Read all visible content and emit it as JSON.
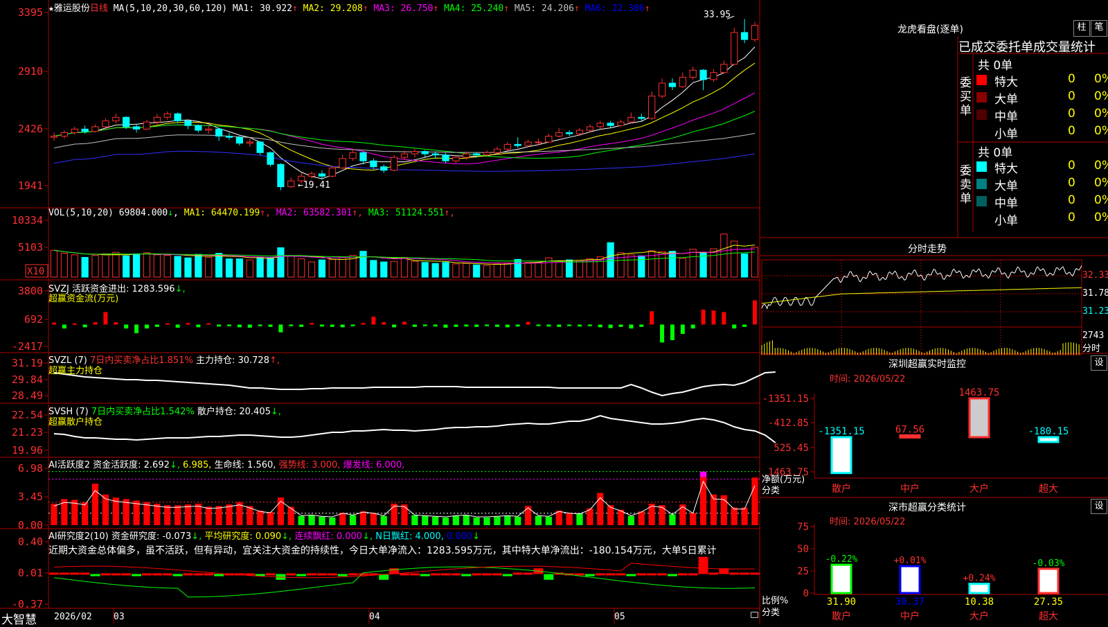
{
  "app": {
    "logo": "大智慧",
    "lock_icon": "lock-icon"
  },
  "stock": {
    "star": "★",
    "name": "雅运股份",
    "period": "日线"
  },
  "main": {
    "ma_label": "MA(5,10,20,30,60,120)",
    "ma": [
      {
        "label": "MA1: 30.922",
        "arrow": "↑",
        "color": "#ffffff"
      },
      {
        "label": "MA2: 29.208",
        "arrow": "↑",
        "color": "#ffff00"
      },
      {
        "label": "MA3: 26.750",
        "arrow": "↑",
        "color": "#ff00ff"
      },
      {
        "label": "MA4: 25.240",
        "arrow": "↑",
        "color": "#00ff00"
      },
      {
        "label": "MA5: 24.206",
        "arrow": "↑",
        "color": "#c0c0c0"
      },
      {
        "label": "MA6: 22.306",
        "arrow": "↑",
        "color": "#0000ff"
      }
    ],
    "y_ticks": [
      "3395",
      "2910",
      "2426",
      "1941"
    ],
    "high_label": "33.95",
    "low_label": "←19.41"
  },
  "vol": {
    "header": "VOL(5,10,20)",
    "value": "69804.000",
    "value_arrow": "↓",
    "ma": [
      {
        "label": "MA1: 64470.199",
        "arrow": "↑",
        "color": "#ffff00"
      },
      {
        "label": "MA2: 63582.301",
        "arrow": "↑",
        "color": "#ff00ff"
      },
      {
        "label": "MA3: 51124.551",
        "arrow": "↑",
        "color": "#00ff00"
      }
    ],
    "y_ticks": [
      "10334",
      "5103"
    ],
    "unit": "X10"
  },
  "svzj": {
    "line1": "SVZJ  活跃资金进出: 1283.596",
    "line1_arrow": "↓,",
    "line2": "超赢资金流(万元)",
    "y_ticks": [
      "3800",
      "692",
      "-2417"
    ]
  },
  "svzl": {
    "prefix": "SVZL (7)",
    "green": "7日内买卖净占比1.851%",
    "white": "主力持仓: 30.728",
    "arrow": "↑,",
    "line2": "超赢主力持仓",
    "y_ticks": [
      "31.19",
      "29.84",
      "28.49"
    ]
  },
  "svsh": {
    "prefix": "SVSH (7)",
    "green": "7日内买卖净占比1.542%",
    "white": "散户持仓: 20.405",
    "arrow": "↓,",
    "line2": "超赢散户持仓",
    "y_ticks": [
      "22.54",
      "21.23",
      "19.96"
    ]
  },
  "ai_active": {
    "title": "AI活跃度2",
    "item1": "资金活跃度: 2.692",
    "item1b": "6.985,",
    "item2": "生命线: 1.560,",
    "item3": "强势线: 3.000,",
    "item4": "爆发线: 6.000,",
    "y_ticks": [
      "6.98",
      "3.45",
      "0.00"
    ]
  },
  "ai_research": {
    "title": "AI研究度2(10)",
    "item1": "资金研究度: -0.073",
    "item2": "平均研究度: 0.090",
    "item3": "连续飘红: 0.000",
    "item4": "N日飘红: 4.000,",
    "item5": "0.000",
    "comment": "近期大资金总体偏多，虽不活跃，但有异动，宜关注大资金的持续性，今日大单净流入：1283.595万元，其中特大单净流出：-180.154万元，大单5日累计",
    "y_ticks": [
      "0.40",
      "0.01",
      "-0.37"
    ]
  },
  "x_axis": [
    "2026/02",
    "03",
    "04",
    "05"
  ],
  "dragon_tiger": {
    "title": "龙虎看盘(逐单)",
    "btn_bar": "柱",
    "btn_pen": "笔",
    "header": "已成交委托单成交量统计",
    "buy": {
      "side_label": "委买单",
      "total": "共 0单",
      "rows": [
        {
          "label": "特大",
          "value": "0",
          "pct": "0%",
          "color": "#ff0000"
        },
        {
          "label": "大单",
          "value": "0",
          "pct": "0%",
          "color": "#8b0000"
        },
        {
          "label": "中单",
          "value": "0",
          "pct": "0%",
          "color": "#500000"
        },
        {
          "label": "小单",
          "value": "0",
          "pct": "0%",
          "color": ""
        }
      ]
    },
    "sell": {
      "side_label": "委卖单",
      "total": "共 0单",
      "rows": [
        {
          "label": "特大",
          "value": "0",
          "pct": "0%",
          "color": "#00ffff"
        },
        {
          "label": "大单",
          "value": "0",
          "pct": "0%",
          "color": "#008080"
        },
        {
          "label": "中单",
          "value": "0",
          "pct": "0%",
          "color": "#006060"
        },
        {
          "label": "小单",
          "value": "0",
          "pct": "0%",
          "color": ""
        }
      ]
    }
  },
  "intraday": {
    "title": "分时走势",
    "price_ticks": [
      "32.33",
      "31.78",
      "31.23"
    ],
    "vol_tick": "2743",
    "vol_unit": "分时"
  },
  "sz_monitor": {
    "title": "深圳超赢实时监控",
    "btn": "设",
    "time": "时间: 2026/05/22",
    "y_ticks": [
      "1463.75",
      "525.45",
      "-412.85",
      "-1351.15"
    ],
    "ylabel1": "净额(万元)",
    "ylabel2": "分类"
  },
  "sz_stats": {
    "title": "深市超赢分类统计",
    "btn": "设",
    "time": "时间: 2026/05/22",
    "y_ticks": [
      "75",
      "50",
      "25",
      "0"
    ],
    "ylabel1": "比例%",
    "ylabel2": "分类"
  },
  "chart_data": [
    {
      "type": "candlestick",
      "title": "雅运股份 日线",
      "y_ticks": [
        19.41,
        24.26,
        29.1,
        33.95
      ],
      "ylim": [
        18.5,
        34.5
      ],
      "annotations": {
        "high": 33.95,
        "low": 19.41
      },
      "candles": [
        [
          23.9,
          24.0,
          24.3,
          23.6
        ],
        [
          24.0,
          24.3,
          24.5,
          23.8
        ],
        [
          24.3,
          24.6,
          24.8,
          24.1
        ],
        [
          24.6,
          24.4,
          24.9,
          24.2
        ],
        [
          24.4,
          24.8,
          25.0,
          24.3
        ],
        [
          24.8,
          25.3,
          25.5,
          24.7
        ],
        [
          25.3,
          25.6,
          25.9,
          25.1
        ],
        [
          25.6,
          24.8,
          25.7,
          24.6
        ],
        [
          24.8,
          24.6,
          25.0,
          24.3
        ],
        [
          24.6,
          25.2,
          25.4,
          24.5
        ],
        [
          25.2,
          25.6,
          25.9,
          25.0
        ],
        [
          25.6,
          25.9,
          26.1,
          25.4
        ],
        [
          25.9,
          25.3,
          26.0,
          25.1
        ],
        [
          25.3,
          24.9,
          25.4,
          24.6
        ],
        [
          24.9,
          24.5,
          25.0,
          24.3
        ],
        [
          24.5,
          24.6,
          24.9,
          24.2
        ],
        [
          24.6,
          24.0,
          24.7,
          23.6
        ],
        [
          24.0,
          23.9,
          24.3,
          23.7
        ],
        [
          23.9,
          23.4,
          24.0,
          23.2
        ],
        [
          23.4,
          23.5,
          23.8,
          23.1
        ],
        [
          23.5,
          22.6,
          23.6,
          22.4
        ],
        [
          22.6,
          21.6,
          22.7,
          21.4
        ],
        [
          21.6,
          19.7,
          21.7,
          19.41
        ],
        [
          19.7,
          20.2,
          20.5,
          19.6
        ],
        [
          20.2,
          20.6,
          20.9,
          20.0
        ],
        [
          20.6,
          20.8,
          21.0,
          20.4
        ],
        [
          20.8,
          20.6,
          21.1,
          20.3
        ],
        [
          20.6,
          21.3,
          21.5,
          20.5
        ],
        [
          21.3,
          22.1,
          22.4,
          21.2
        ],
        [
          22.1,
          22.6,
          22.9,
          21.9
        ],
        [
          22.6,
          21.9,
          22.7,
          21.6
        ],
        [
          21.9,
          21.4,
          22.1,
          21.2
        ],
        [
          21.4,
          21.1,
          21.6,
          20.9
        ],
        [
          21.1,
          22.2,
          22.4,
          21.0
        ],
        [
          22.2,
          22.5,
          22.8,
          22.0
        ],
        [
          22.5,
          22.7,
          22.9,
          22.2
        ],
        [
          22.7,
          22.5,
          22.8,
          22.2
        ],
        [
          22.5,
          22.4,
          22.7,
          22.1
        ],
        [
          22.4,
          21.9,
          22.6,
          21.7
        ],
        [
          21.9,
          22.2,
          22.4,
          21.7
        ],
        [
          22.2,
          22.5,
          22.7,
          22.0
        ],
        [
          22.5,
          22.4,
          22.6,
          22.2
        ],
        [
          22.4,
          22.6,
          22.8,
          22.3
        ],
        [
          22.6,
          22.9,
          23.1,
          22.5
        ],
        [
          22.9,
          23.3,
          23.5,
          22.8
        ],
        [
          23.3,
          23.2,
          23.9,
          23.0
        ],
        [
          23.2,
          23.5,
          23.7,
          23.1
        ],
        [
          23.5,
          23.5,
          23.8,
          23.2
        ],
        [
          23.5,
          24.0,
          24.2,
          23.4
        ],
        [
          24.0,
          24.3,
          24.7,
          23.9
        ],
        [
          24.3,
          24.2,
          24.5,
          24.0
        ],
        [
          24.2,
          24.5,
          24.7,
          24.0
        ],
        [
          24.5,
          24.8,
          25.0,
          24.3
        ],
        [
          24.8,
          25.1,
          25.3,
          24.6
        ],
        [
          25.1,
          24.9,
          25.3,
          24.7
        ],
        [
          24.9,
          25.2,
          25.4,
          24.8
        ],
        [
          25.2,
          25.6,
          26.0,
          25.1
        ],
        [
          25.6,
          25.5,
          25.9,
          25.3
        ],
        [
          25.5,
          27.4,
          27.8,
          25.4
        ],
        [
          27.4,
          28.5,
          28.9,
          27.2
        ],
        [
          28.5,
          28.2,
          28.9,
          27.9
        ],
        [
          28.2,
          29.0,
          29.4,
          28.1
        ],
        [
          29.0,
          29.6,
          29.9,
          28.8
        ],
        [
          29.6,
          28.8,
          29.7,
          27.9
        ],
        [
          28.8,
          29.4,
          29.7,
          28.6
        ],
        [
          29.4,
          30.1,
          30.4,
          29.3
        ],
        [
          30.1,
          32.8,
          33.2,
          30.0
        ],
        [
          32.8,
          32.2,
          33.95,
          31.9
        ],
        [
          32.2,
          33.4,
          33.7,
          32.0
        ]
      ]
    },
    {
      "type": "bar",
      "title": "VOL(5,10,20)",
      "y_ticks": [
        5103,
        10334
      ],
      "ylim": [
        0,
        11200
      ],
      "unit": "X10",
      "values": [
        5300,
        4700,
        4400,
        3900,
        4300,
        4600,
        4900,
        4200,
        4600,
        4800,
        4400,
        4300,
        4100,
        3800,
        4500,
        3900,
        4700,
        3600,
        3600,
        3400,
        3900,
        3800,
        5800,
        4200,
        3600,
        3000,
        3400,
        3500,
        3900,
        4300,
        5100,
        3300,
        3000,
        3100,
        3900,
        3100,
        2900,
        2700,
        2900,
        2600,
        2700,
        2400,
        2300,
        2600,
        2800,
        3500,
        2900,
        2900,
        3800,
        3100,
        3400,
        3300,
        3600,
        4000,
        6800,
        4800,
        4400,
        4200,
        5200,
        5000,
        5100,
        3700,
        5500,
        4800,
        5600,
        8500,
        7100,
        4600,
        5900,
        6400,
        5200,
        5800,
        4300,
        10300,
        7000
      ]
    },
    {
      "type": "bar",
      "title": "SVZJ 超赢资金流(万元)",
      "y_ticks": [
        -2417,
        692,
        3800
      ],
      "ylim": [
        -2800,
        4300
      ],
      "values": [
        250,
        -500,
        150,
        -350,
        300,
        1600,
        300,
        -500,
        -1100,
        -500,
        -300,
        150,
        -400,
        200,
        -350,
        150,
        -250,
        -200,
        -350,
        -400,
        -200,
        -300,
        -1000,
        -200,
        -300,
        200,
        -250,
        -300,
        -350,
        -200,
        200,
        1000,
        300,
        -350,
        350,
        -300,
        -200,
        -250,
        -400,
        -300,
        -250,
        -300,
        -200,
        -300,
        -350,
        -250,
        350,
        -200,
        -250,
        -300,
        -200,
        -250,
        -200,
        -350,
        -450,
        -300,
        -500,
        -300,
        1700,
        -2300,
        -2000,
        -1200,
        -500,
        1900,
        1800,
        1600,
        -500,
        -300,
        3100,
        4000,
        1500
      ]
    },
    {
      "type": "line",
      "title": "SVZL 超赢主力持仓",
      "y_ticks": [
        28.49,
        29.84,
        31.19
      ],
      "ylim": [
        28.2,
        31.5
      ]
    },
    {
      "type": "line",
      "title": "SVSH 超赢散户持仓",
      "y_ticks": [
        19.96,
        21.23,
        22.54
      ],
      "ylim": [
        19.7,
        22.8
      ]
    },
    {
      "type": "bar",
      "title": "AI活跃度2",
      "y_ticks": [
        0.0,
        3.45,
        6.98
      ],
      "ylim": [
        0,
        7.4
      ],
      "values": [
        2.8,
        3.4,
        3.3,
        3.0,
        5.4,
        4.0,
        3.6,
        3.4,
        3.2,
        3.0,
        2.8,
        2.6,
        2.6,
        2.7,
        2.8,
        2.4,
        2.5,
        2.7,
        3.0,
        2.5,
        1.9,
        1.7,
        3.6,
        2.4,
        1.2,
        1.3,
        1.1,
        1.0,
        1.6,
        1.3,
        1.8,
        1.6,
        1.2,
        2.8,
        2.7,
        1.3,
        1.2,
        1.1,
        1.0,
        1.2,
        1.3,
        1.0,
        1.0,
        1.1,
        1.2,
        1.1,
        2.5,
        1.2,
        1.1,
        1.9,
        1.6,
        1.5,
        2.2,
        4.2,
        2.6,
        2.0,
        1.2,
        1.8,
        2.8,
        2.6,
        1.4,
        2.7,
        1.6,
        6.9,
        4.0,
        3.9,
        2.3,
        2.3,
        6.2,
        6.6,
        3.0
      ]
    },
    {
      "type": "bar",
      "title": "AI研究度2(10)",
      "y_ticks": [
        -0.37,
        0.01,
        0.4
      ],
      "ylim": [
        -0.42,
        0.45
      ]
    },
    {
      "type": "bar",
      "title": "深圳超赢实时监控",
      "categories": [
        "散户",
        "中户",
        "大户",
        "超大"
      ],
      "values": [
        -1351.15,
        67.56,
        1463.75,
        -180.15
      ],
      "y_ticks": [
        -1351.15,
        -412.85,
        525.45,
        1463.75
      ]
    },
    {
      "type": "bar",
      "title": "深市超赢分类统计",
      "categories": [
        "散户",
        "中户",
        "大户",
        "超大"
      ],
      "values": [
        31.9,
        30.37,
        10.38,
        27.35
      ],
      "changes": [
        "-0.22%",
        "+0.01%",
        "+0.24%",
        "-0.03%"
      ],
      "y_ticks": [
        0,
        25,
        50,
        75
      ]
    }
  ]
}
